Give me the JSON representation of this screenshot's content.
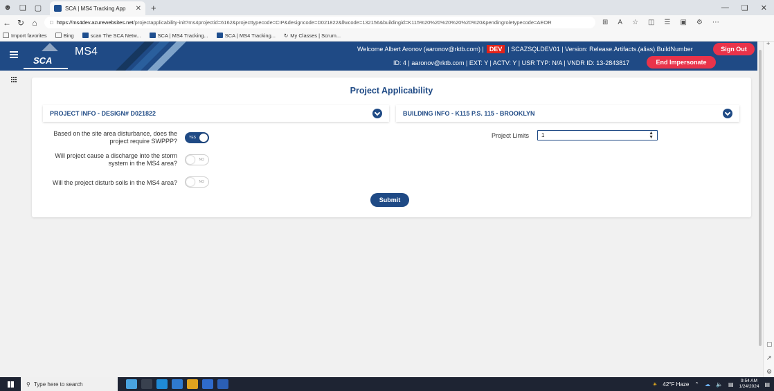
{
  "browser": {
    "tab_title": "SCA | MS4 Tracking App",
    "url_host": "https://ms4dev.azurewebsites.net",
    "url_path": "/projectapplicability-init?ms4projectid=6162&projecttypecode=CIP&designcode=D021822&llwcode=132156&buildingid=K115%20%20%20%20%20%20&pendingroletypecode=AEOR",
    "favorites": [
      "Import favorites",
      "Bing",
      "scan The SCA Netw...",
      "SCA | MS4 Tracking...",
      "SCA | MS4 Tracking...",
      "My Classes | Scrum..."
    ]
  },
  "header": {
    "logo_text": "SCA",
    "app_name": "MS4",
    "welcome": "Welcome Albert Aronov (aaronov@rktb.com) |",
    "env_badge": "DEV",
    "server_info": "| SCAZSQLDEV01 | Version: Release.Artifacts.(alias).BuildNumber",
    "user_details": "ID: 4 | aaronov@rktb.com | EXT: Y | ACTV: Y | USR TYP: N/A | VNDR ID: 13-2843817",
    "sign_out_label": "Sign Out",
    "end_impersonate_label": "End Impersonate"
  },
  "main": {
    "title": "Project Applicability",
    "project_info_label": "PROJECT INFO - DESIGN# D021822",
    "building_info_label": "BUILDING INFO - K115 P.S. 115 - BROOKLYN",
    "questions": [
      {
        "text": "Based on the site area disturbance, does the project require SWPPP?",
        "toggle_label": "YES",
        "checked": true
      },
      {
        "text": "Will project cause a discharge into the storm system in the MS4 area?",
        "toggle_label": "NO",
        "checked": false
      },
      {
        "text": "Will the project disturb soils in the MS4 area?",
        "toggle_label": "NO",
        "checked": false
      }
    ],
    "project_limits_label": "Project Limits",
    "project_limits_value": "1",
    "submit_label": "Submit"
  },
  "taskbar": {
    "search_placeholder": "Type here to search",
    "weather": "42°F Haze",
    "time": "9:54 AM",
    "date": "1/24/2024"
  },
  "colors": {
    "brand_blue": "#1f4a85",
    "alert_red": "#e9334a",
    "dev_red": "#e2231a"
  }
}
